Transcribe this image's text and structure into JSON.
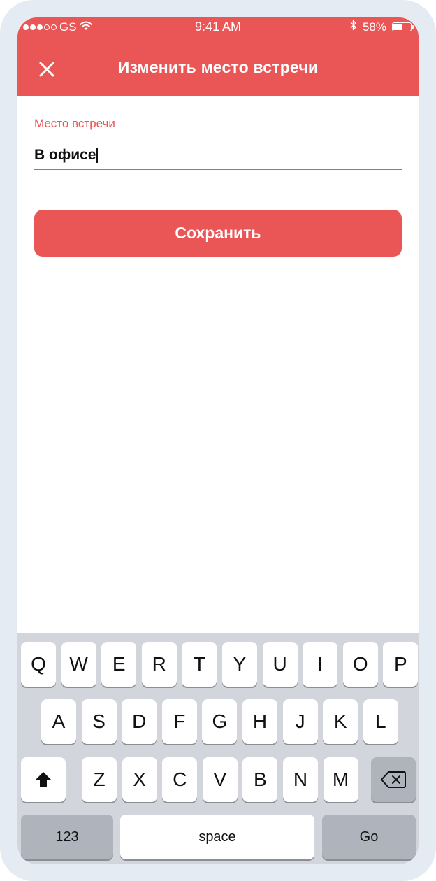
{
  "status_bar": {
    "carrier": "GS",
    "time": "9:41 AM",
    "battery_percent": "58%",
    "battery_level": 0.58,
    "signal_dots_filled": 3,
    "signal_dots_total": 5
  },
  "header": {
    "title": "Изменить место встречи",
    "close_icon": "close-icon",
    "background": "#ea5555"
  },
  "form": {
    "field_label": "Место встречи",
    "field_value": "В офисе",
    "save_label": "Сохранить"
  },
  "keyboard": {
    "row1": [
      "Q",
      "W",
      "E",
      "R",
      "T",
      "Y",
      "U",
      "I",
      "O",
      "P"
    ],
    "row2": [
      "A",
      "S",
      "D",
      "F",
      "G",
      "H",
      "J",
      "K",
      "L"
    ],
    "row3": [
      "Z",
      "X",
      "C",
      "V",
      "B",
      "N",
      "M"
    ],
    "shift_icon": "shift-arrow-icon",
    "backspace_icon": "backspace-icon",
    "numbers_label": "123",
    "space_label": "space",
    "go_label": "Go"
  },
  "colors": {
    "accent": "#ea5555",
    "keyboard_bg": "#d2d5dc",
    "key_dark": "#aeb3bc"
  }
}
